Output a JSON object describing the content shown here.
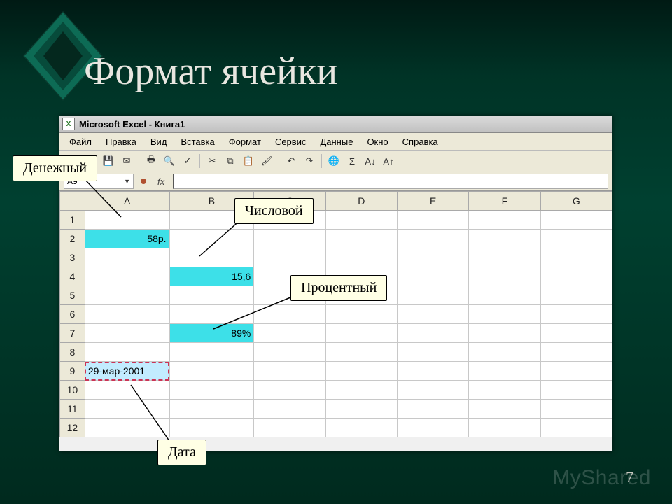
{
  "slide": {
    "title": "Формат ячейки",
    "page_number": "7",
    "watermark": "MyShared"
  },
  "excel": {
    "title": "Microsoft Excel - Книга1",
    "menu": [
      "Файл",
      "Правка",
      "Вид",
      "Вставка",
      "Формат",
      "Сервис",
      "Данные",
      "Окно",
      "Справка"
    ],
    "name_box": "A9",
    "fx_label": "fx",
    "columns": [
      "A",
      "B",
      "C",
      "D",
      "E",
      "F",
      "G"
    ],
    "rows": 12,
    "cells": {
      "A2": "58р.",
      "B4": "15,6",
      "B7": "89%",
      "A9": "29-мар-2001"
    }
  },
  "callouts": {
    "money": "Денежный",
    "number": "Числовой",
    "percent": "Процентный",
    "date": "Дата"
  }
}
